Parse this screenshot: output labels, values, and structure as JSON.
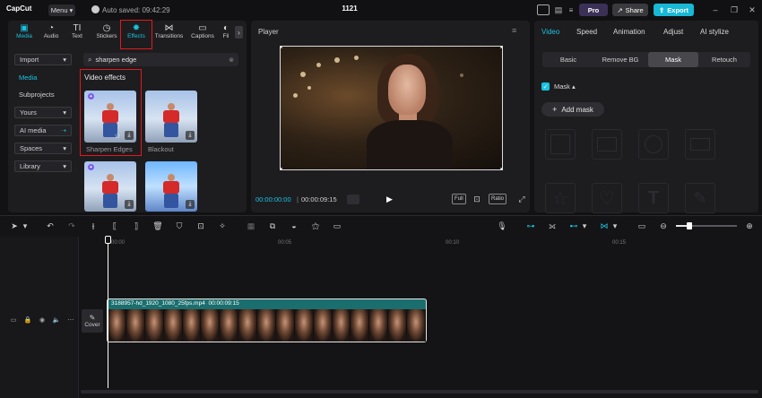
{
  "app": {
    "logo": "CapCut",
    "menu_label": "Menu",
    "autosave": "Auto saved: 09:42:29",
    "project_title": "1121",
    "pro_label": "Pro",
    "share_label": "Share",
    "export_label": "Export"
  },
  "media_tabs": [
    {
      "label": "Media"
    },
    {
      "label": "Audio"
    },
    {
      "label": "Text"
    },
    {
      "label": "Stickers"
    },
    {
      "label": "Effects"
    },
    {
      "label": "Transitions"
    },
    {
      "label": "Captions"
    },
    {
      "label": "Fil"
    }
  ],
  "sidebar": {
    "import": "Import",
    "media": "Media",
    "subprojects": "Subprojects",
    "yours": "Yours",
    "ai_media": "AI media",
    "spaces": "Spaces",
    "library": "Library"
  },
  "search": {
    "value": "sharpen edge"
  },
  "effects": {
    "section_title": "Video effects",
    "items": [
      {
        "label": "Sharpen Edges"
      },
      {
        "label": "Blackout"
      }
    ]
  },
  "player": {
    "title": "Player",
    "current_time": "00:00:00:00",
    "total_time": "00:00:09:15",
    "full_label": "Full",
    "ratio_label": "Ratio"
  },
  "right_panel": {
    "tabs": [
      {
        "label": "Video"
      },
      {
        "label": "Speed"
      },
      {
        "label": "Animation"
      },
      {
        "label": "Adjust"
      },
      {
        "label": "AI stylize"
      }
    ],
    "subtabs": [
      {
        "label": "Basic"
      },
      {
        "label": "Remove BG"
      },
      {
        "label": "Mask"
      },
      {
        "label": "Retouch"
      }
    ],
    "mask_label": "Mask",
    "add_mask_label": "Add mask"
  },
  "timeline": {
    "ticks": [
      "00:00",
      "00:05",
      "00:10",
      "00:15"
    ],
    "cover_label": "Cover",
    "clip_name": "3188957-hd_1920_1080_25fps.mp4",
    "clip_duration": "00:00:09:15"
  },
  "colors": {
    "accent": "#19c2e0",
    "highlight": "#e0191a",
    "clip": "#1b6e6e"
  }
}
